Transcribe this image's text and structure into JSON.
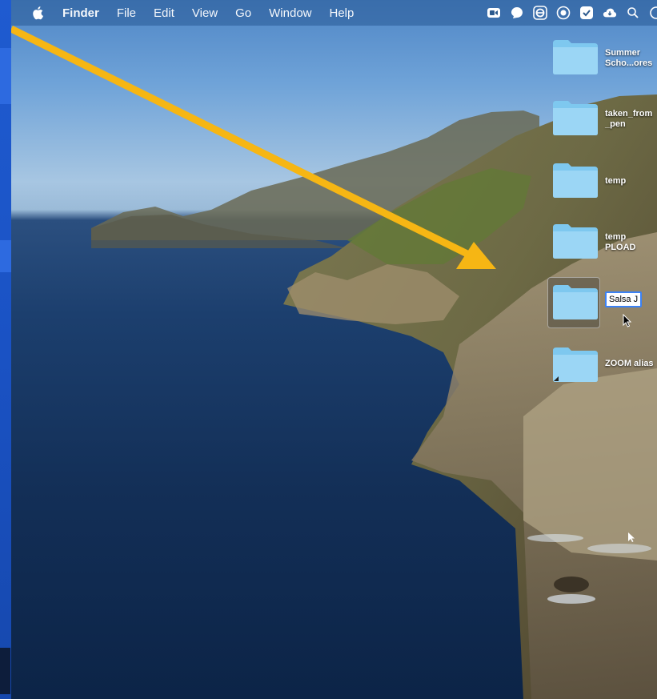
{
  "menubar": {
    "apple_icon": "apple-icon",
    "app_name": "Finder",
    "items": [
      "File",
      "Edit",
      "View",
      "Go",
      "Window",
      "Help"
    ],
    "status_icons": [
      "zoom-icon",
      "bubble-icon",
      "e-icon",
      "circle-icon",
      "check-icon",
      "cloud-icon",
      "search-icon"
    ]
  },
  "desktop_icons": [
    {
      "label_line1": "Summer",
      "label_line2": "Scho...ores"
    },
    {
      "label_line1": "taken_from",
      "label_line2": "_pen"
    },
    {
      "label_line1": "temp",
      "label_line2": ""
    },
    {
      "label_line1": "temp",
      "label_line2": "PLOAD"
    },
    {
      "rename_value": "Salsa J"
    },
    {
      "label_line1": "ZOOM alias",
      "label_line2": ""
    }
  ],
  "colors": {
    "folder": "#8fd1f4",
    "arrow": "#f6b614",
    "menubar": "#3b6e9f"
  }
}
